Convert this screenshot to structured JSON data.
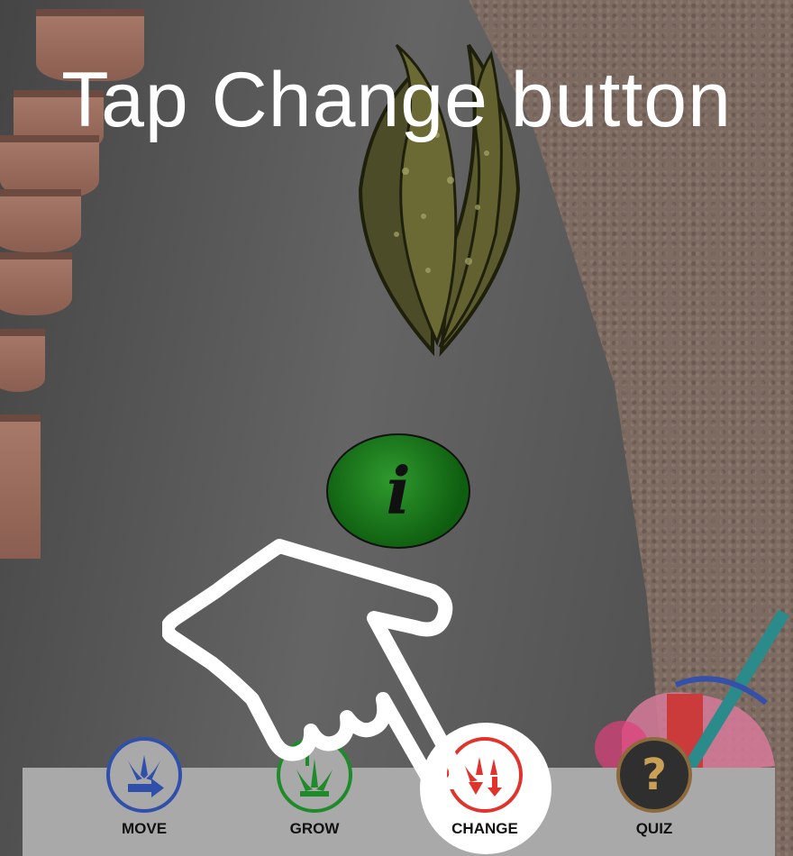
{
  "instruction": {
    "text": "Tap Change button"
  },
  "info_button": {
    "icon": "info-icon",
    "glyph": "i",
    "color": "#1f7a1f"
  },
  "toolbar": {
    "tools": [
      {
        "label": "MOVE",
        "icon": "move-icon",
        "color": "#2f4faa",
        "active": false
      },
      {
        "label": "GROW",
        "icon": "grow-icon",
        "color": "#1f8a2a",
        "active": false
      },
      {
        "label": "CHANGE",
        "icon": "change-icon",
        "color": "#e0332c",
        "active": true
      },
      {
        "label": "QUIZ",
        "icon": "quiz-icon",
        "glyph": "?",
        "color": "#caa055",
        "active": false
      }
    ]
  },
  "tutorial_pointer": {
    "icon": "pointing-hand-icon"
  }
}
